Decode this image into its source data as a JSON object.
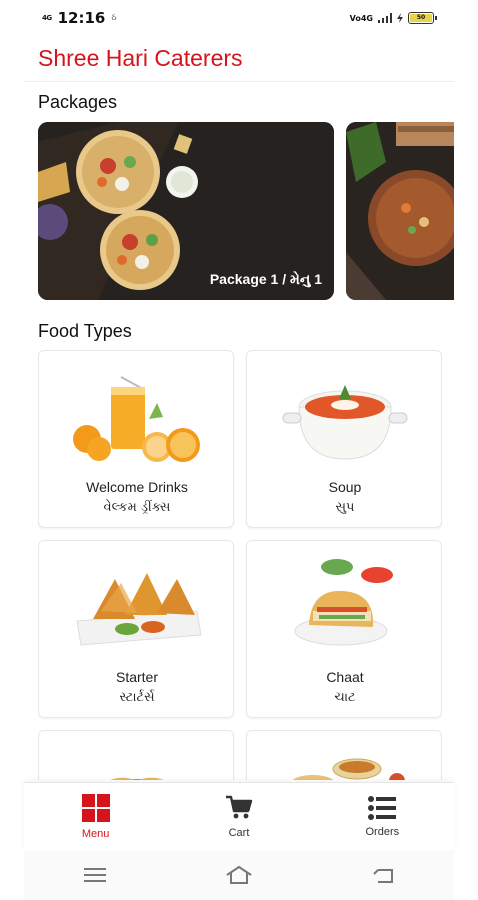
{
  "status_bar": {
    "network_tag": "4G",
    "time": "12:16",
    "extra": "ઠ",
    "right_tag": "Vo4G",
    "battery": "50"
  },
  "header": {
    "title": "Shree Hari Caterers"
  },
  "packages": {
    "title": "Packages",
    "items": [
      {
        "label": "Package 1 / મેનુ 1"
      },
      {
        "label": ""
      }
    ]
  },
  "food_types": {
    "title": "Food Types",
    "items": [
      {
        "name_en": "Welcome Drinks",
        "name_gu": "વેલ્કમ ડ્રીંક્સ"
      },
      {
        "name_en": "Soup",
        "name_gu": "સુપ"
      },
      {
        "name_en": "Starter",
        "name_gu": "સ્ટાર્ટર્સ"
      },
      {
        "name_en": "Chaat",
        "name_gu": "ચાટ"
      },
      {
        "name_en": "",
        "name_gu": ""
      },
      {
        "name_en": "",
        "name_gu": ""
      }
    ]
  },
  "bottom_nav": {
    "items": [
      {
        "label": "Menu",
        "icon": "grid-icon",
        "active": true
      },
      {
        "label": "Cart",
        "icon": "cart-icon",
        "active": false
      },
      {
        "label": "Orders",
        "icon": "list-icon",
        "active": false
      }
    ]
  },
  "colors": {
    "accent": "#d6141c"
  }
}
